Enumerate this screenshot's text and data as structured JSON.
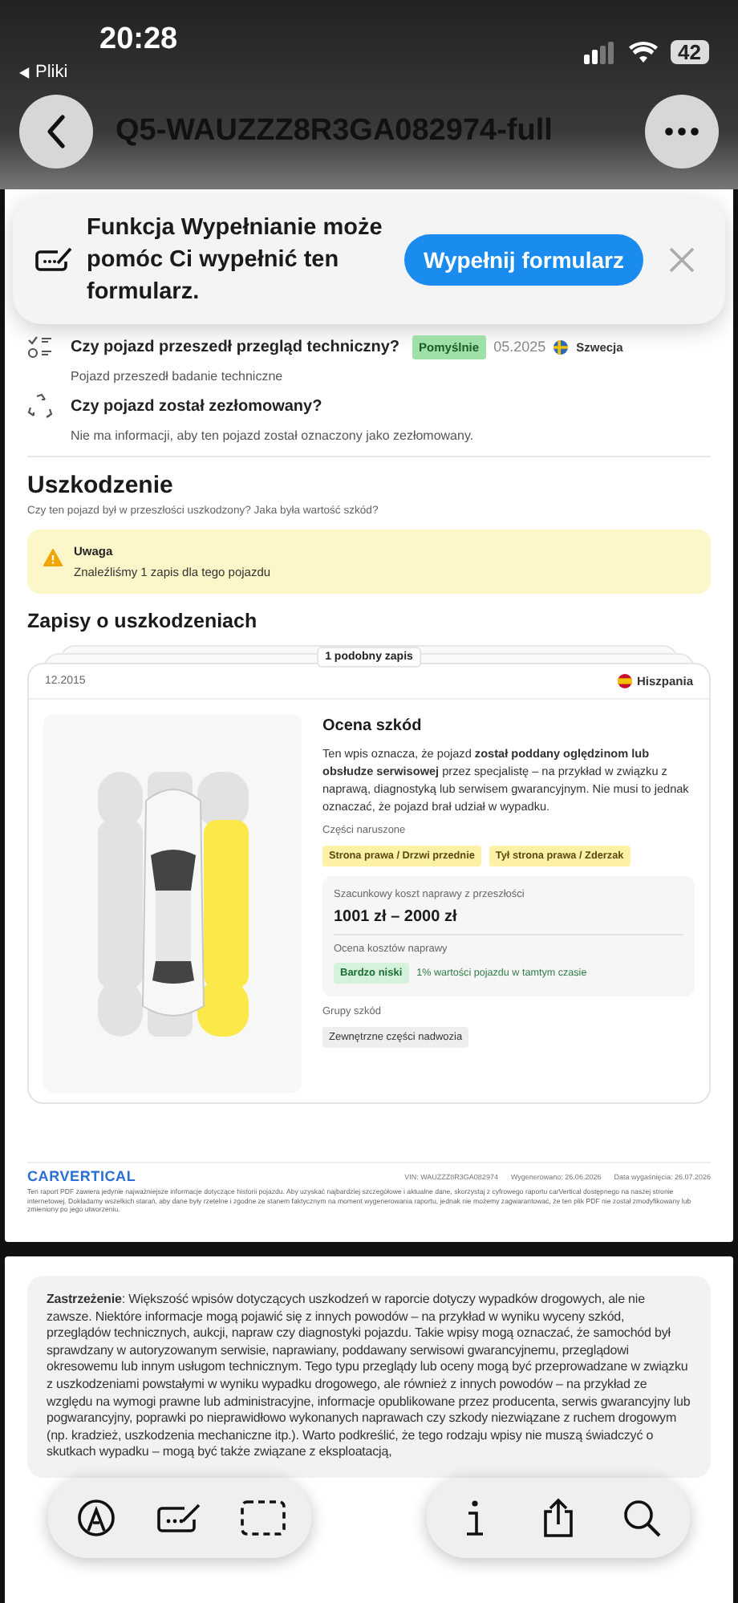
{
  "status_bar": {
    "time": "20:28",
    "back_app": "Pliki",
    "battery": "42"
  },
  "nav": {
    "title": "Q5-WAUZZZ8R3GA082974-full"
  },
  "autofill_banner": {
    "text": "Funkcja Wypełnianie może pomóc Ci wypełnić ten formularz.",
    "button": "Wypełnij formularz"
  },
  "checks": [
    {
      "kind": "inspection",
      "question": "Czy pojazd przeszedł przegląd techniczny?",
      "badge": "Pomyślnie",
      "date": "05.2025",
      "country": "Szwecja",
      "description": "Pojazd przeszedł badanie techniczne"
    },
    {
      "kind": "scrapped",
      "question": "Czy pojazd został zezłomowany?",
      "description": "Nie ma informacji, aby ten pojazd został oznaczony jako zezłomowany."
    }
  ],
  "damage": {
    "title": "Uszkodzenie",
    "subtitle": "Czy ten pojazd był w przeszłości uszkodzony? Jaka była wartość szkód?",
    "alert": {
      "title": "Uwaga",
      "text": "Znaleźliśmy 1 zapis dla tego pojazdu"
    }
  },
  "records": {
    "title": "Zapisy o uszkodzeniach",
    "similar": "1 podobny zapis",
    "record": {
      "date": "12.2015",
      "country": "Hiszpania",
      "heading": "Ocena szkód",
      "description": "Ten wpis oznacza, że pojazd **został poddany oględzinom lub obsłudze serwisowej** przez specjalistę – na przykład w związku z naprawą, diagnostyką lub serwisem gwarancyjnym. Nie musi to jednak oznaczać, że pojazd brał udział w wypadku.",
      "parts_label": "Części naruszone",
      "parts": [
        "Strona prawa / Drzwi przednie",
        "Tył strona prawa / Zderzak"
      ],
      "cost_label": "Szacunkowy koszt naprawy z przeszłości",
      "cost": "1001 zł – 2000 zł",
      "rating_label": "Ocena kosztów naprawy",
      "rating": "Bardzo niski",
      "rating_note": "1% wartości pojazdu w tamtym czasie",
      "groups_label": "Grupy szkód",
      "groups": [
        "Zewnętrzne części nadwozia"
      ]
    }
  },
  "footer": {
    "brand": "CARVERTICAL",
    "vin": "VIN: WAUZZZ8R3GA082974",
    "generated": "Wygenerowano: 26.06.2026",
    "expires": "Data wygaśnięcia: 26.07.2026",
    "note": "Ten raport PDF zawiera jedynie najważniejsze informacje dotyczące historii pojazdu. Aby uzyskać najbardziej szczegółowe i aktualne dane, skorzystaj z cyfrowego raportu carVertical dostępnego na naszej stronie internetowej. Dokładamy wszelkich starań, aby dane były rzetelne i zgodne ze stanem faktycznym na moment wygenerowania raportu, jednak nie możemy zagwarantować, że ten plik PDF nie został zmodyfikowany lub zmieniony po jego utworzeniu."
  },
  "disclaimer": {
    "text": "**Zastrzeżenie**: Większość wpisów dotyczących uszkodzeń w raporcie dotyczy wypadków drogowych, ale nie zawsze. Niektóre informacje mogą pojawić się z innych powodów – na przykład w wyniku wyceny szkód, przeglądów technicznych, aukcji, napraw czy diagnostyki pojazdu. Takie wpisy mogą oznaczać, że samochód był sprawdzany w autoryzowanym serwisie, naprawiany, poddawany serwisowi gwarancyjnemu, przeglądowi okresowemu lub innym usługom technicznym. Tego typu przeglądy lub oceny mogą być przeprowadzane w związku z uszkodzeniami powstałymi w wyniku wypadku drogowego, ale również z innych powodów – na przykład ze względu na wymogi prawne lub administracyjne, informacje opublikowane przez producenta, serwis gwarancyjny lub pogwarancyjny, poprawki po nieprawidłowo wykonanych naprawach czy szkody niezwiązane z ruchem drogowym (np. kradzież, uszkodzenia mechaniczne itp.). Warto podkreślić, że tego rodzaju wpisy nie muszą świadczyć o skutkach wypadku – mogą być także związane z eksploatacją,"
  }
}
